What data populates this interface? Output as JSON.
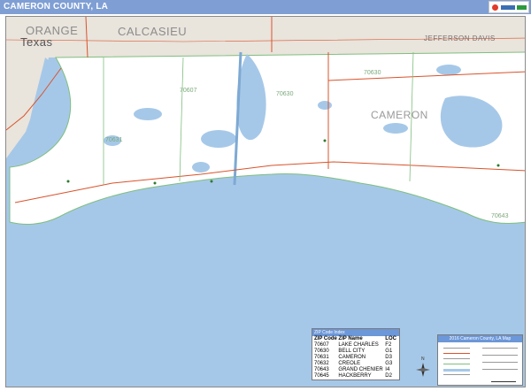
{
  "title": "CAMERON COUNTY, LA",
  "brand_icon": "publisher-logo-icon",
  "map": {
    "land_color": "#ffffff",
    "water_color": "#a6c8e8",
    "neighbor_color": "#e9e4dc",
    "road_color": "#d9532b",
    "boundary_color": "#7fbf7f",
    "labels": {
      "orange": "ORANGE",
      "calcasieu": "CALCASIEU",
      "jefferson_davis": "JEFFERSON DAVIS",
      "texas": "Texas",
      "cameron": "CAMERON"
    },
    "zip_labels": [
      "70631",
      "70607",
      "70630",
      "70630",
      "70643"
    ]
  },
  "zip_table": {
    "title": "ZIP Code Index",
    "headers": [
      "ZIP Code",
      "ZIP Name",
      "LOC"
    ],
    "rows": [
      [
        "70607",
        "LAKE CHARLES",
        "F2"
      ],
      [
        "70630",
        "BELL CITY",
        "G1"
      ],
      [
        "70631",
        "CAMERON",
        "D3"
      ],
      [
        "70632",
        "CREOLE",
        "G3"
      ],
      [
        "70643",
        "GRAND CHENIER",
        "I4"
      ],
      [
        "70645",
        "HACKBERRY",
        "D2"
      ]
    ]
  },
  "legend": {
    "title": "2016 Cameron County, LA Map"
  }
}
